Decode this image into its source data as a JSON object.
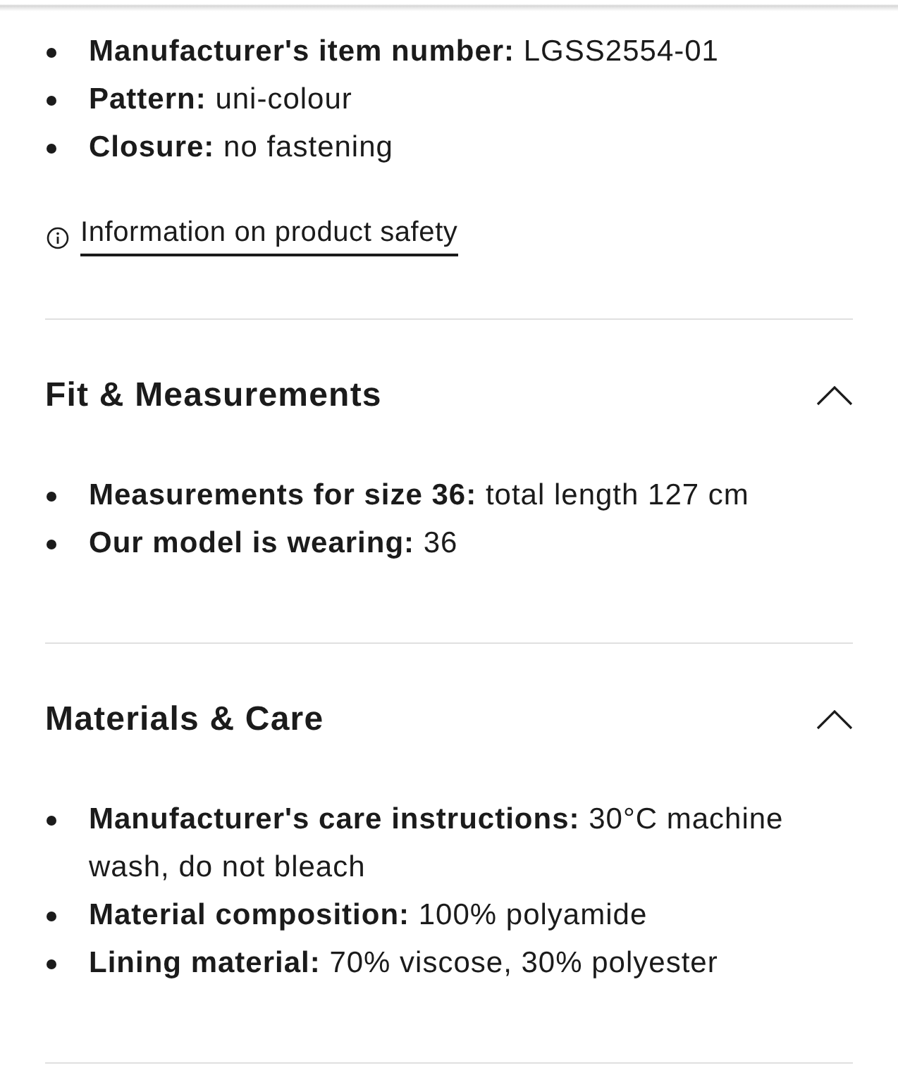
{
  "details": {
    "items": [
      {
        "text": "**Manufacturer's item number:** LGSS2554-01"
      },
      {
        "text": "**Pattern:** uni-colour"
      },
      {
        "text": "**Closure:** no fastening"
      }
    ]
  },
  "safety_link": {
    "label": "Information on product safety"
  },
  "sections": [
    {
      "title": "Fit & Measurements",
      "expanded": true,
      "items": [
        {
          "text": "**Measurements for size 36:** total length 127 cm"
        },
        {
          "text": "**Our model is wearing:** 36"
        }
      ]
    },
    {
      "title": "Materials & Care",
      "expanded": true,
      "items": [
        {
          "text": "**Manufacturer's care instructions:** 30°C machine wash, do not bleach"
        },
        {
          "text": "**Material composition:** 100% polyamide"
        },
        {
          "text": "**Lining material:** 70% viscose, 30% polyester"
        }
      ]
    }
  ]
}
